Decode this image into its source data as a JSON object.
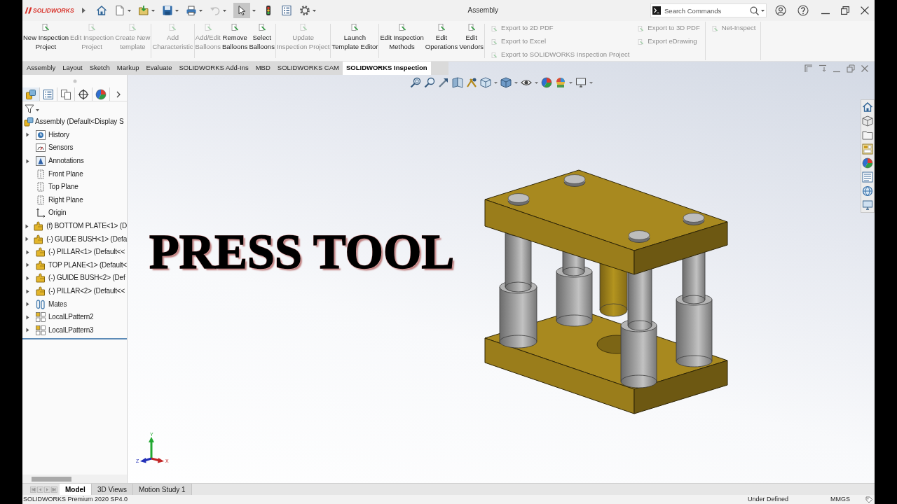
{
  "app": {
    "logo_text": "SOLIDWORKS",
    "title": "Assembly"
  },
  "quick_access": [
    {
      "kind": "home",
      "dropdown": false,
      "disabled": false,
      "pressed": false
    },
    {
      "kind": "new",
      "dropdown": true,
      "disabled": false,
      "pressed": false
    },
    {
      "kind": "open",
      "dropdown": true,
      "disabled": false,
      "pressed": false
    },
    {
      "kind": "save",
      "dropdown": true,
      "disabled": false,
      "pressed": false
    },
    {
      "kind": "print",
      "dropdown": true,
      "disabled": false,
      "pressed": false
    },
    {
      "kind": "undo",
      "dropdown": true,
      "disabled": true,
      "pressed": false
    },
    {
      "kind": "select",
      "dropdown": true,
      "disabled": false,
      "pressed": true
    },
    {
      "kind": "rebuild",
      "dropdown": false,
      "disabled": false,
      "pressed": false
    },
    {
      "kind": "properties",
      "dropdown": false,
      "disabled": false,
      "pressed": false
    },
    {
      "kind": "options",
      "dropdown": true,
      "disabled": false,
      "pressed": false
    }
  ],
  "search": {
    "placeholder": "Search Commands"
  },
  "ribbon": [
    {
      "kind": "large",
      "buttons": [
        {
          "label_lines": [
            "New Inspection",
            "Project"
          ],
          "disabled": false
        },
        {
          "label_lines": [
            "Edit Inspection",
            "Project"
          ],
          "disabled": true
        },
        {
          "label_lines": [
            "Create New",
            "template"
          ],
          "disabled": true
        }
      ]
    },
    {
      "kind": "large",
      "buttons": [
        {
          "label_lines": [
            "Add",
            "Characteristic"
          ],
          "disabled": true
        }
      ]
    },
    {
      "kind": "large",
      "buttons": [
        {
          "label_lines": [
            "Add/Edit",
            "Balloons"
          ],
          "disabled": true
        },
        {
          "label_lines": [
            "Remove",
            "Balloons"
          ],
          "disabled": false
        },
        {
          "label_lines": [
            "Select",
            "Balloons"
          ],
          "disabled": false
        }
      ]
    },
    {
      "kind": "large",
      "buttons": [
        {
          "label_lines": [
            "Update",
            "Inspection Project"
          ],
          "disabled": true
        }
      ]
    },
    {
      "kind": "large",
      "buttons": [
        {
          "label_lines": [
            "Launch",
            "Template Editor"
          ],
          "disabled": false
        }
      ]
    },
    {
      "kind": "large",
      "buttons": [
        {
          "label_lines": [
            "Edit Inspection",
            "Methods"
          ],
          "disabled": false
        },
        {
          "label_lines": [
            "Edit",
            "Operations"
          ],
          "disabled": false
        },
        {
          "label_lines": [
            "Edit",
            "Vendors"
          ],
          "disabled": false
        }
      ]
    },
    {
      "kind": "small",
      "columns": [
        [
          {
            "label": "Export to 2D PDF",
            "disabled": true
          },
          {
            "label": "Export to Excel",
            "disabled": true
          },
          {
            "label": "Export to SOLIDWORKS Inspection Project",
            "disabled": true
          }
        ],
        [
          {
            "label": "Export to 3D PDF",
            "disabled": true
          },
          {
            "label": "Export eDrawing",
            "disabled": true
          }
        ]
      ]
    },
    {
      "kind": "small",
      "columns": [
        [
          {
            "label": "Net-Inspect",
            "disabled": true
          }
        ]
      ]
    }
  ],
  "tabs": [
    {
      "label": "Assembly",
      "selected": false
    },
    {
      "label": "Layout",
      "selected": false
    },
    {
      "label": "Sketch",
      "selected": false
    },
    {
      "label": "Markup",
      "selected": false
    },
    {
      "label": "Evaluate",
      "selected": false
    },
    {
      "label": "SOLIDWORKS Add-Ins",
      "selected": false
    },
    {
      "label": "MBD",
      "selected": false
    },
    {
      "label": "SOLIDWORKS CAM",
      "selected": false
    },
    {
      "label": "SOLIDWORKS Inspection",
      "selected": true
    }
  ],
  "feature_manager": {
    "tree": {
      "label": "Assembly (Default<Display S",
      "kind": "assembly",
      "children": [
        {
          "label": "History",
          "kind": "history",
          "has_children": true
        },
        {
          "label": "Sensors",
          "kind": "sensors",
          "has_children": false
        },
        {
          "label": "Annotations",
          "kind": "annotations",
          "has_children": true
        },
        {
          "label": "Front Plane",
          "kind": "plane",
          "has_children": false
        },
        {
          "label": "Top Plane",
          "kind": "plane",
          "has_children": false
        },
        {
          "label": "Right Plane",
          "kind": "plane",
          "has_children": false
        },
        {
          "label": "Origin",
          "kind": "origin",
          "has_children": false
        },
        {
          "label": "(f) BOTTOM PLATE<1> (D",
          "kind": "part",
          "has_children": true
        },
        {
          "label": "(-) GUIDE BUSH<1> (Defa",
          "kind": "part",
          "has_children": true
        },
        {
          "label": "(-) PILLAR<1> (Default<<",
          "kind": "part",
          "has_children": true
        },
        {
          "label": "TOP PLANE<1> (Default<",
          "kind": "part",
          "has_children": true
        },
        {
          "label": "(-) GUIDE BUSH<2> (Def",
          "kind": "part",
          "has_children": true
        },
        {
          "label": "(-) PILLAR<2> (Default<<",
          "kind": "part",
          "has_children": true
        },
        {
          "label": "Mates",
          "kind": "mates",
          "has_children": true
        },
        {
          "label": "LocalLPattern2",
          "kind": "pattern",
          "has_children": true
        },
        {
          "label": "LocalLPattern3",
          "kind": "pattern",
          "has_children": true
        }
      ]
    }
  },
  "viewport": {
    "overlay_title": "PRESS TOOL",
    "triad": {
      "y": "Y",
      "z": "Z",
      "x": "X"
    }
  },
  "bottom_tabs": [
    {
      "label": "Model",
      "selected": true
    },
    {
      "label": "3D Views",
      "selected": false
    },
    {
      "label": "Motion Study 1",
      "selected": false
    }
  ],
  "status_bar": {
    "product": "SOLIDWORKS Premium 2020 SP4.0",
    "state": "Under Defined",
    "units": "MMGS"
  }
}
